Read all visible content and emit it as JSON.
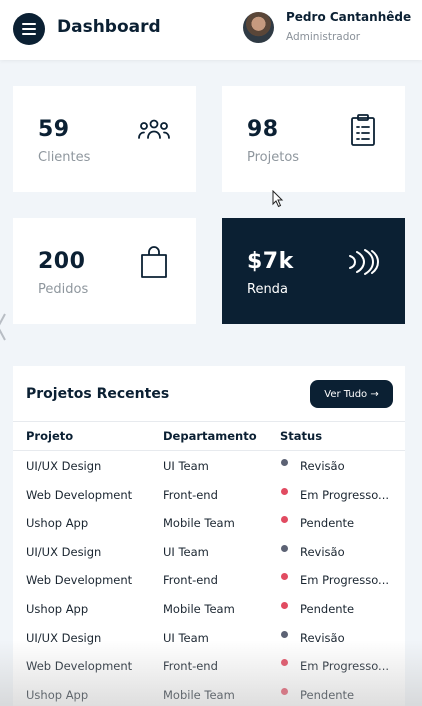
{
  "header": {
    "title": "Dashboard",
    "user_name": "Pedro Cantanhêde",
    "user_role": "Administrador"
  },
  "cards": [
    {
      "value": "59",
      "label": "Clientes",
      "icon": "users-icon"
    },
    {
      "value": "98",
      "label": "Projetos",
      "icon": "clipboard-icon"
    },
    {
      "value": "200",
      "label": "Pedidos",
      "icon": "shopping-bag-icon"
    },
    {
      "value": "$7k",
      "label": "Renda",
      "icon": "cash-icon"
    }
  ],
  "projects": {
    "title": "Projetos Recentes",
    "button_label": "Ver Tudo →",
    "columns": [
      "Projeto",
      "Departamento",
      "Status"
    ],
    "rows": [
      {
        "project": "UI/UX Design",
        "department": "UI Team",
        "status": "Revisão",
        "status_color": "#5c6274"
      },
      {
        "project": "Web Development",
        "department": "Front-end",
        "status": "Em Progresso...",
        "status_color": "#e14b61"
      },
      {
        "project": "Ushop App",
        "department": "Mobile Team",
        "status": "Pendente",
        "status_color": "#e14b61"
      },
      {
        "project": "UI/UX Design",
        "department": "UI Team",
        "status": "Revisão",
        "status_color": "#5c6274"
      },
      {
        "project": "Web Development",
        "department": "Front-end",
        "status": "Em Progresso...",
        "status_color": "#e14b61"
      },
      {
        "project": "Ushop App",
        "department": "Mobile Team",
        "status": "Pendente",
        "status_color": "#e14b61"
      },
      {
        "project": "UI/UX Design",
        "department": "UI Team",
        "status": "Revisão",
        "status_color": "#5c6274"
      },
      {
        "project": "Web Development",
        "department": "Front-end",
        "status": "Em Progresso...",
        "status_color": "#e14b61"
      },
      {
        "project": "Ushop App",
        "department": "Mobile Team",
        "status": "Pendente",
        "status_color": "#e14b61"
      }
    ]
  },
  "colors": {
    "primary": "#0b2033",
    "background": "#f1f5f9",
    "muted_text": "#8f979e"
  }
}
